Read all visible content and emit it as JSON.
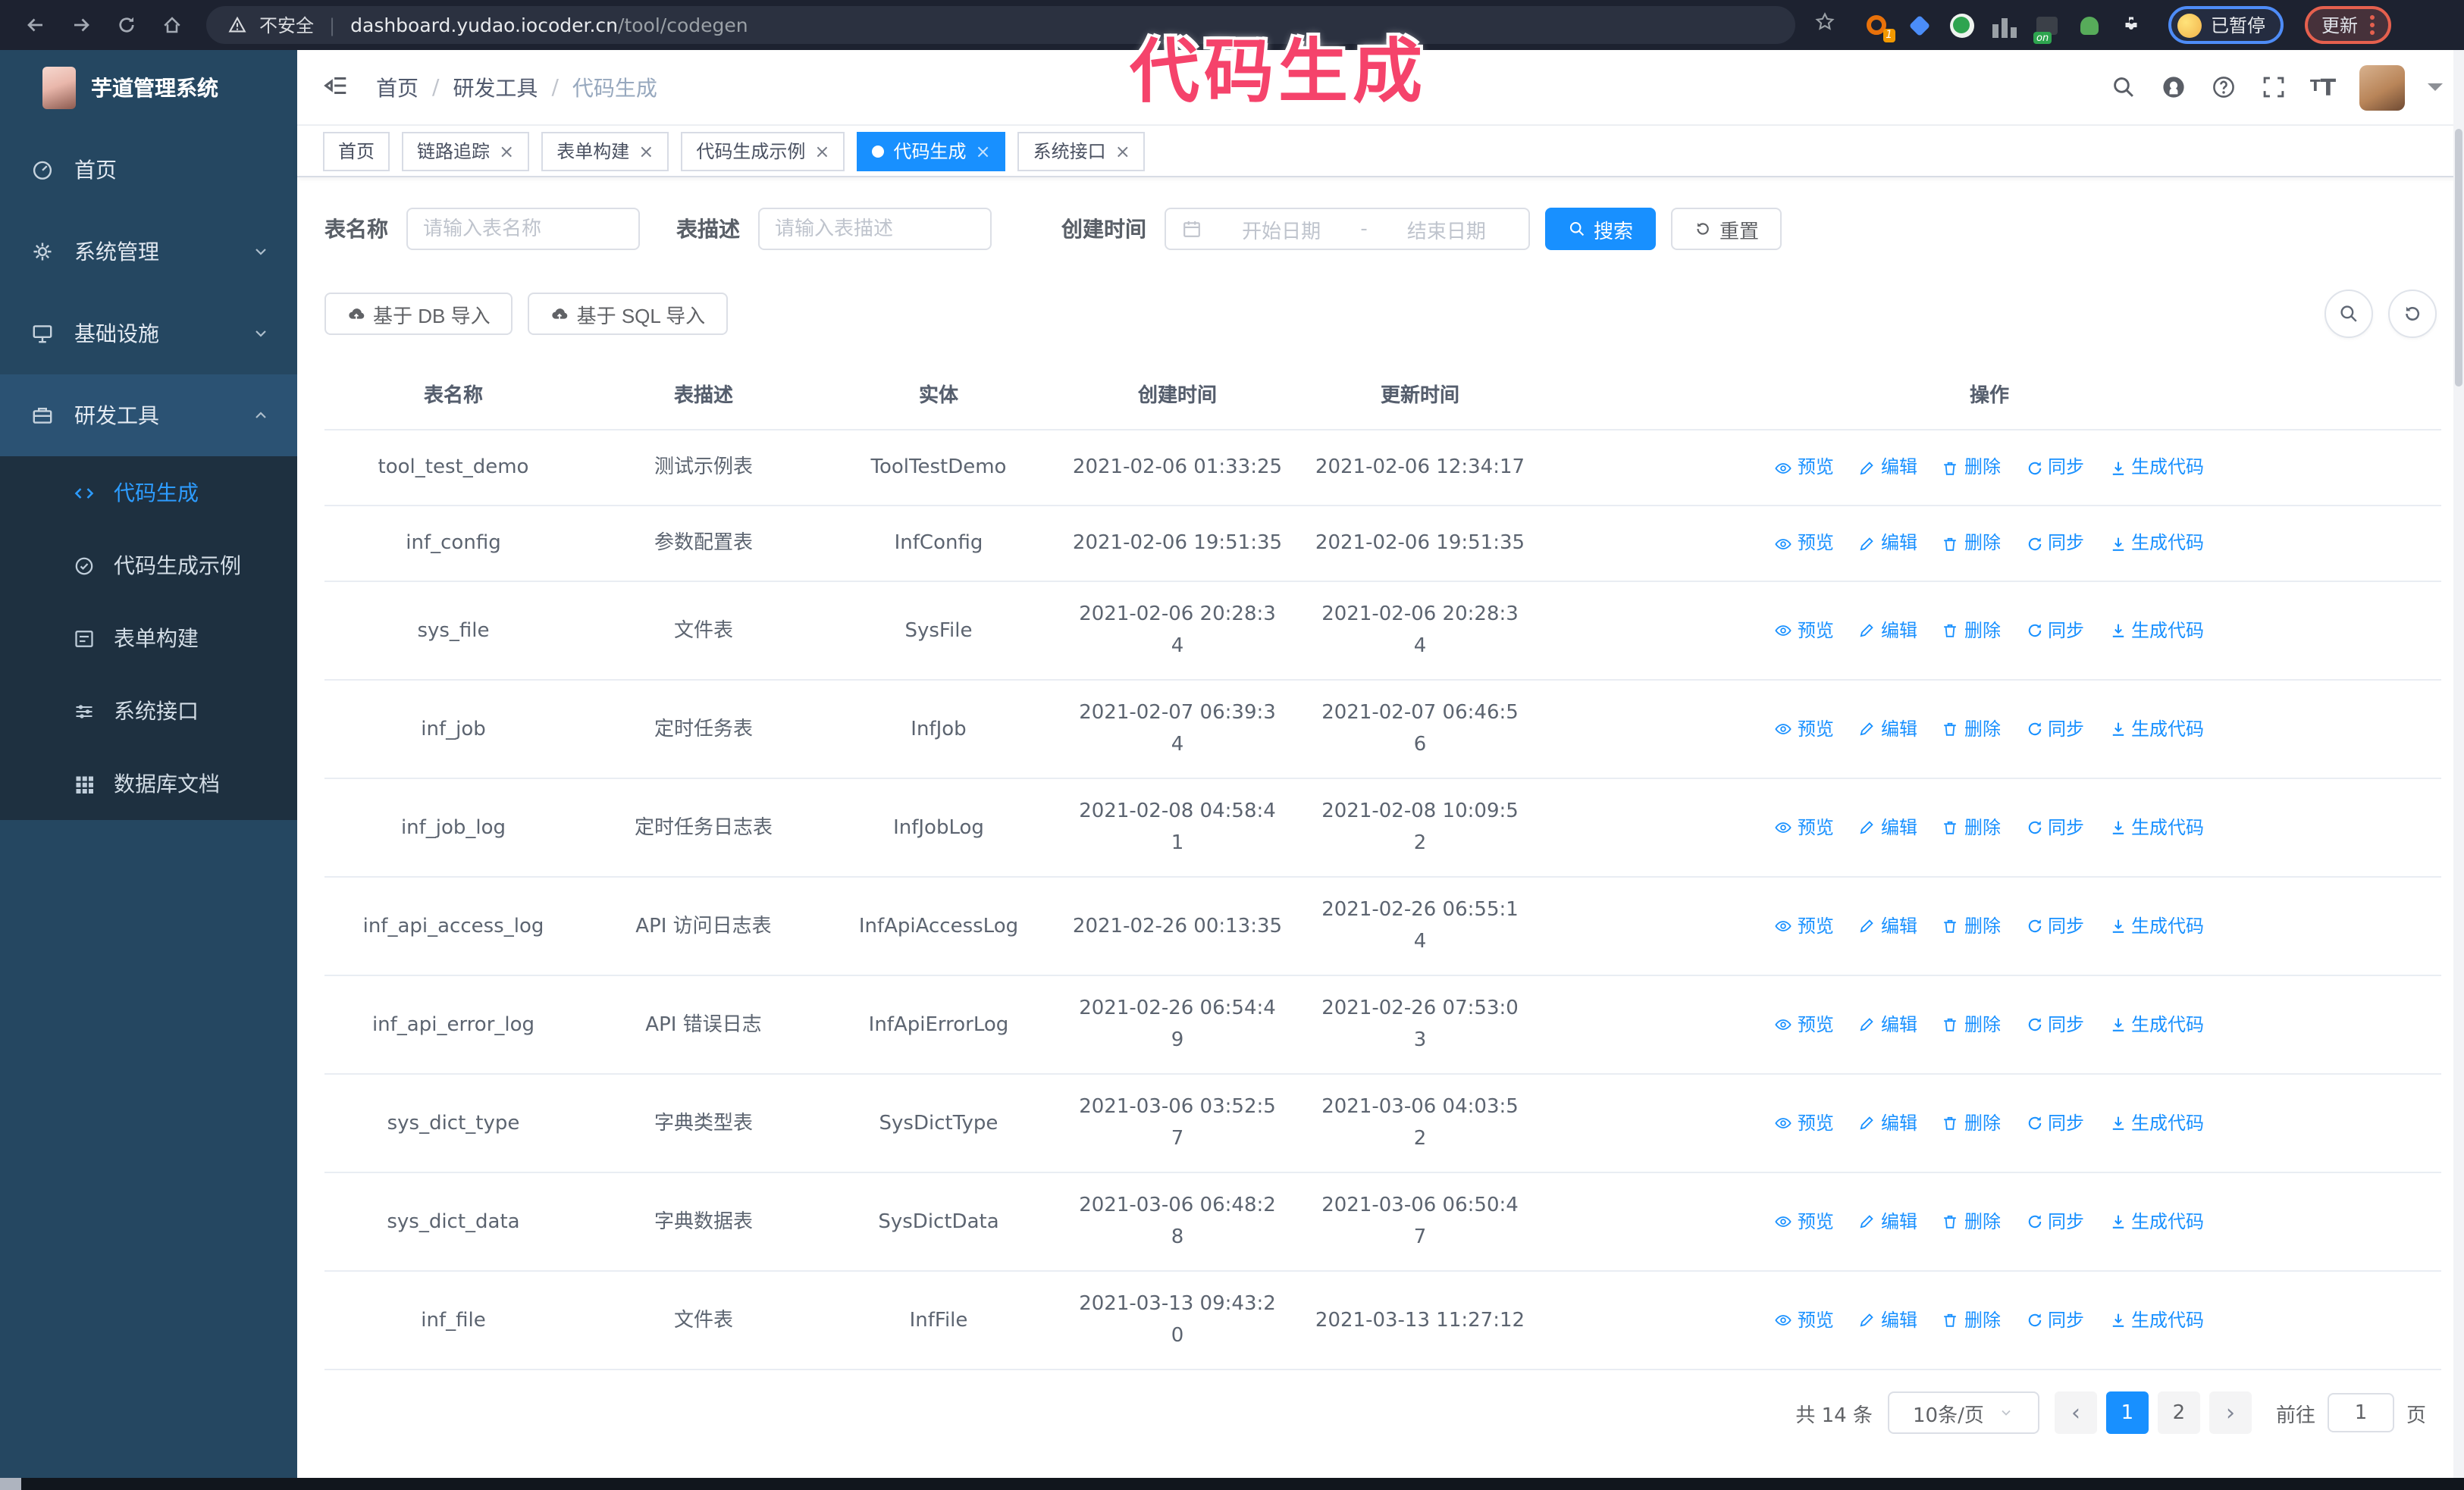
{
  "colors": {
    "accent": "#1890ff",
    "overlay_pink": "#f5436b",
    "sidebar_bg": "#254761",
    "submenu_bg": "#1e3040",
    "parent_active_bg": "#2b5273"
  },
  "overlay": {
    "text": "代码生成"
  },
  "browser": {
    "security_label": "不安全",
    "url_host": "dashboard.yudao.iocoder.cn",
    "url_path": "/tool/codegen",
    "ext_badge_count": "1",
    "ext_badge_on": "on",
    "paused_label": "已暂停",
    "update_label": "更新"
  },
  "sidebar": {
    "title": "芋道管理系统",
    "items": [
      {
        "label": "首页",
        "icon": "gauge",
        "chevron": null,
        "active": false
      },
      {
        "label": "系统管理",
        "icon": "gear",
        "chevron": "down",
        "active": false
      },
      {
        "label": "基础设施",
        "icon": "monitor",
        "chevron": "down",
        "active": false
      },
      {
        "label": "研发工具",
        "icon": "briefcase",
        "chevron": "up",
        "active": true,
        "children": [
          {
            "label": "代码生成",
            "icon": "code",
            "active": true
          },
          {
            "label": "代码生成示例",
            "icon": "badge",
            "active": false
          },
          {
            "label": "表单构建",
            "icon": "form",
            "active": false
          },
          {
            "label": "系统接口",
            "icon": "sliders",
            "active": false
          },
          {
            "label": "数据库文档",
            "icon": "grid",
            "active": false
          }
        ]
      }
    ]
  },
  "header": {
    "breadcrumb": [
      "首页",
      "研发工具",
      "代码生成"
    ],
    "icons": [
      "search",
      "github",
      "help",
      "fullscreen",
      "font-size"
    ]
  },
  "tabs": [
    {
      "label": "首页",
      "closable": false,
      "active": false
    },
    {
      "label": "链路追踪",
      "closable": true,
      "active": false
    },
    {
      "label": "表单构建",
      "closable": true,
      "active": false
    },
    {
      "label": "代码生成示例",
      "closable": true,
      "active": false
    },
    {
      "label": "代码生成",
      "closable": true,
      "active": true
    },
    {
      "label": "系统接口",
      "closable": true,
      "active": false
    }
  ],
  "filters": {
    "name_label": "表名称",
    "name_placeholder": "请输入表名称",
    "desc_label": "表描述",
    "desc_placeholder": "请输入表描述",
    "time_label": "创建时间",
    "start_placeholder": "开始日期",
    "range_separator": "-",
    "end_placeholder": "结束日期",
    "search_label": "搜索",
    "reset_label": "重置"
  },
  "toolbar": {
    "import_db_label": "基于 DB 导入",
    "import_sql_label": "基于 SQL 导入"
  },
  "table": {
    "columns": [
      "表名称",
      "表描述",
      "实体",
      "创建时间",
      "更新时间",
      "操作"
    ],
    "actions": [
      {
        "key": "preview",
        "label": "预览",
        "icon": "eye"
      },
      {
        "key": "edit",
        "label": "编辑",
        "icon": "pen"
      },
      {
        "key": "delete",
        "label": "删除",
        "icon": "trash"
      },
      {
        "key": "sync",
        "label": "同步",
        "icon": "sync"
      },
      {
        "key": "generate",
        "label": "生成代码",
        "icon": "download"
      }
    ],
    "rows": [
      {
        "name": "tool_test_demo",
        "desc": "测试示例表",
        "entity": "ToolTestDemo",
        "created": "2021-02-06 01:33:25",
        "updated": "2021-02-06 12:34:17"
      },
      {
        "name": "inf_config",
        "desc": "参数配置表",
        "entity": "InfConfig",
        "created": "2021-02-06 19:51:35",
        "updated": "2021-02-06 19:51:35"
      },
      {
        "name": "sys_file",
        "desc": "文件表",
        "entity": "SysFile",
        "created": "2021-02-06 20:28:3\n4",
        "updated": "2021-02-06 20:28:3\n4"
      },
      {
        "name": "inf_job",
        "desc": "定时任务表",
        "entity": "InfJob",
        "created": "2021-02-07 06:39:3\n4",
        "updated": "2021-02-07 06:46:5\n6"
      },
      {
        "name": "inf_job_log",
        "desc": "定时任务日志表",
        "entity": "InfJobLog",
        "created": "2021-02-08 04:58:4\n1",
        "updated": "2021-02-08 10:09:5\n2"
      },
      {
        "name": "inf_api_access_log",
        "desc": "API 访问日志表",
        "entity": "InfApiAccessLog",
        "created": "2021-02-26 00:13:35",
        "updated": "2021-02-26 06:55:1\n4"
      },
      {
        "name": "inf_api_error_log",
        "desc": "API 错误日志",
        "entity": "InfApiErrorLog",
        "created": "2021-02-26 06:54:4\n9",
        "updated": "2021-02-26 07:53:0\n3"
      },
      {
        "name": "sys_dict_type",
        "desc": "字典类型表",
        "entity": "SysDictType",
        "created": "2021-03-06 03:52:5\n7",
        "updated": "2021-03-06 04:03:5\n2"
      },
      {
        "name": "sys_dict_data",
        "desc": "字典数据表",
        "entity": "SysDictData",
        "created": "2021-03-06 06:48:2\n8",
        "updated": "2021-03-06 06:50:4\n7"
      },
      {
        "name": "inf_file",
        "desc": "文件表",
        "entity": "InfFile",
        "created": "2021-03-13 09:43:2\n0",
        "updated": "2021-03-13 11:27:12"
      }
    ]
  },
  "pagination": {
    "total_label": "共 14 条",
    "page_size_label": "10条/页",
    "pages": [
      "1",
      "2"
    ],
    "active_page": "1",
    "goto_prefix": "前往",
    "goto_value": "1",
    "goto_suffix": "页"
  }
}
